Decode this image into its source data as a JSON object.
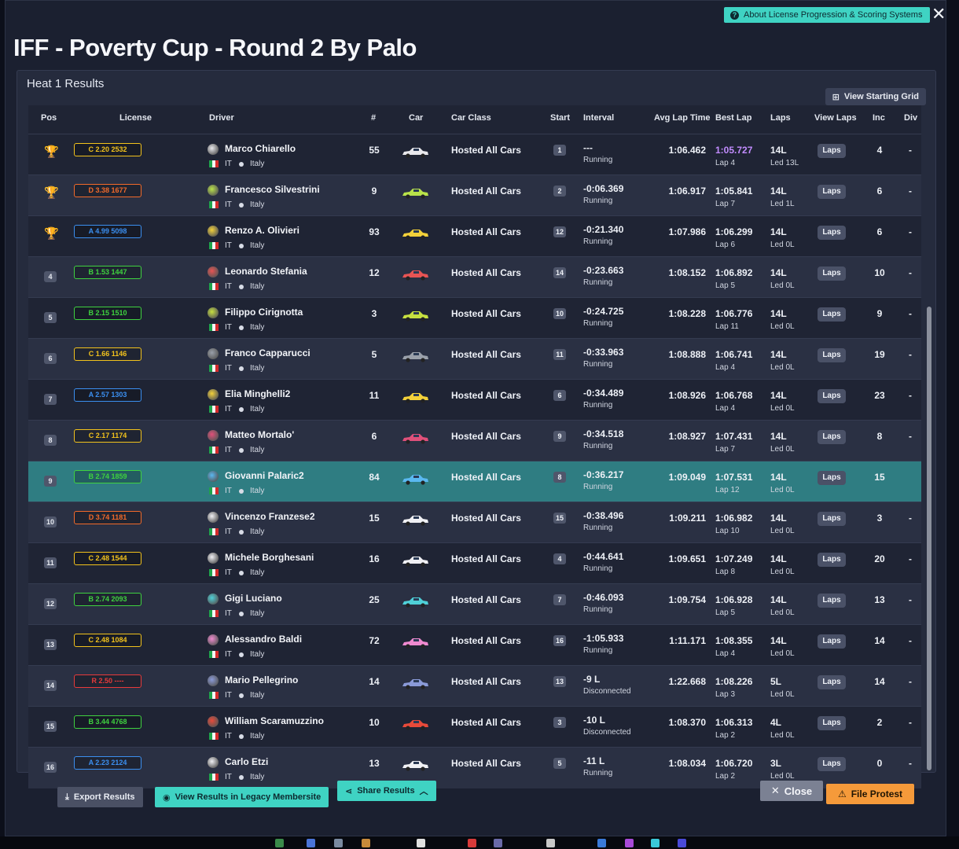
{
  "window": {
    "help_label": "About License Progression & Scoring Systems",
    "close_glyph": "✕"
  },
  "event_title": "IFF - Poverty Cup - Round 2 By Palo",
  "heat_title": "Heat 1 Results",
  "starting_grid_label": "View Starting Grid",
  "columns": {
    "pos": "Pos",
    "license": "License",
    "driver": "Driver",
    "number": "#",
    "car": "Car",
    "car_class": "Car Class",
    "start": "Start",
    "interval": "Interval",
    "avg_lap": "Avg Lap Time",
    "best_lap": "Best Lap",
    "laps": "Laps",
    "view_laps": "View Laps",
    "inc": "Inc",
    "div": "Div"
  },
  "laps_button_label": "Laps",
  "rows": [
    {
      "pos": "1",
      "trophy": "gold",
      "license": "C 2.20 2532",
      "lic_color": "#f2c21c",
      "driver": "Marco Chiarello",
      "country_code": "IT",
      "country": "Italy",
      "number": "55",
      "car_color": "#e8e8ec",
      "car_class": "Hosted All Cars",
      "start": "1",
      "interval": "---",
      "status": "Running",
      "avg": "1:06.462",
      "best": "1:05.727",
      "best_lap": "Lap 4",
      "best_purple": true,
      "laps": "14L",
      "led": "Led 13L",
      "inc": "4",
      "div": "-"
    },
    {
      "pos": "2",
      "trophy": "silver",
      "license": "D 3.38 1677",
      "lic_color": "#f26a2a",
      "driver": "Francesco Silvestrini",
      "country_code": "IT",
      "country": "Italy",
      "number": "9",
      "car_color": "#b9e34a",
      "car_class": "Hosted All Cars",
      "start": "2",
      "interval": "-0:06.369",
      "status": "Running",
      "avg": "1:06.917",
      "best": "1:05.841",
      "best_lap": "Lap 7",
      "laps": "14L",
      "led": "Led 1L",
      "inc": "6",
      "div": "-"
    },
    {
      "pos": "3",
      "trophy": "bronze",
      "license": "A 4.99 5098",
      "lic_color": "#3b8ff0",
      "driver": "Renzo A. Olivieri",
      "country_code": "IT",
      "country": "Italy",
      "number": "93",
      "car_color": "#f3d13a",
      "car_class": "Hosted All Cars",
      "start": "12",
      "interval": "-0:21.340",
      "status": "Running",
      "avg": "1:07.986",
      "best": "1:06.299",
      "best_lap": "Lap 6",
      "laps": "14L",
      "led": "Led 0L",
      "inc": "6",
      "div": "-"
    },
    {
      "pos": "4",
      "license": "B 1.53 1447",
      "lic_color": "#3fd23f",
      "driver": "Leonardo Stefania",
      "country_code": "IT",
      "country": "Italy",
      "number": "12",
      "car_color": "#e85454",
      "car_class": "Hosted All Cars",
      "start": "14",
      "interval": "-0:23.663",
      "status": "Running",
      "avg": "1:08.152",
      "best": "1:06.892",
      "best_lap": "Lap 5",
      "laps": "14L",
      "led": "Led 0L",
      "inc": "10",
      "div": "-"
    },
    {
      "pos": "5",
      "license": "B 2.15 1510",
      "lic_color": "#3fd23f",
      "driver": "Filippo Cirignotta",
      "country_code": "IT",
      "country": "Italy",
      "number": "3",
      "car_color": "#c6e040",
      "car_class": "Hosted All Cars",
      "start": "10",
      "interval": "-0:24.725",
      "status": "Running",
      "avg": "1:08.228",
      "best": "1:06.776",
      "best_lap": "Lap 11",
      "laps": "14L",
      "led": "Led 0L",
      "inc": "9",
      "div": "-"
    },
    {
      "pos": "6",
      "license": "C 1.66 1146",
      "lic_color": "#f2c21c",
      "driver": "Franco Capparucci",
      "country_code": "IT",
      "country": "Italy",
      "number": "5",
      "car_color": "#9aa0aa",
      "car_class": "Hosted All Cars",
      "start": "11",
      "interval": "-0:33.963",
      "status": "Running",
      "avg": "1:08.888",
      "best": "1:06.741",
      "best_lap": "Lap 4",
      "laps": "14L",
      "led": "Led 0L",
      "inc": "19",
      "div": "-"
    },
    {
      "pos": "7",
      "license": "A 2.57 1303",
      "lic_color": "#3b8ff0",
      "driver": "Elia Minghelli2",
      "country_code": "IT",
      "country": "Italy",
      "number": "11",
      "car_color": "#f3d13a",
      "car_class": "Hosted All Cars",
      "start": "6",
      "interval": "-0:34.489",
      "status": "Running",
      "avg": "1:08.926",
      "best": "1:06.768",
      "best_lap": "Lap 4",
      "laps": "14L",
      "led": "Led 0L",
      "inc": "23",
      "div": "-"
    },
    {
      "pos": "8",
      "license": "C 2.17 1174",
      "lic_color": "#f2c21c",
      "driver": "Matteo Mortalo'",
      "country_code": "IT",
      "country": "Italy",
      "number": "6",
      "car_color": "#e0507a",
      "car_class": "Hosted All Cars",
      "start": "9",
      "interval": "-0:34.518",
      "status": "Running",
      "avg": "1:08.927",
      "best": "1:07.431",
      "best_lap": "Lap 7",
      "laps": "14L",
      "led": "Led 0L",
      "inc": "8",
      "div": "-"
    },
    {
      "pos": "9",
      "license": "B 2.74 1859",
      "lic_color": "#3fd23f",
      "driver": "Giovanni Palaric2",
      "country_code": "IT",
      "country": "Italy",
      "number": "84",
      "car_color": "#5ab8f0",
      "car_class": "Hosted All Cars",
      "start": "8",
      "interval": "-0:36.217",
      "status": "Running",
      "avg": "1:09.049",
      "best": "1:07.531",
      "best_lap": "Lap 12",
      "laps": "14L",
      "led": "Led 0L",
      "inc": "15",
      "div": "",
      "highlight": true
    },
    {
      "pos": "10",
      "license": "D 3.74 1181",
      "lic_color": "#f26a2a",
      "driver": "Vincenzo Franzese2",
      "country_code": "IT",
      "country": "Italy",
      "number": "15",
      "car_color": "#f0f0f4",
      "car_class": "Hosted All Cars",
      "start": "15",
      "interval": "-0:38.496",
      "status": "Running",
      "avg": "1:09.211",
      "best": "1:06.982",
      "best_lap": "Lap 10",
      "laps": "14L",
      "led": "Led 0L",
      "inc": "3",
      "div": "-"
    },
    {
      "pos": "11",
      "license": "C 2.48 1544",
      "lic_color": "#f2c21c",
      "driver": "Michele Borghesani",
      "country_code": "IT",
      "country": "Italy",
      "number": "16",
      "car_color": "#f0f0f4",
      "car_class": "Hosted All Cars",
      "start": "4",
      "interval": "-0:44.641",
      "status": "Running",
      "avg": "1:09.651",
      "best": "1:07.249",
      "best_lap": "Lap 8",
      "laps": "14L",
      "led": "Led 0L",
      "inc": "20",
      "div": "-"
    },
    {
      "pos": "12",
      "license": "B 2.74 2093",
      "lic_color": "#3fd23f",
      "driver": "Gigi Luciano",
      "country_code": "IT",
      "country": "Italy",
      "number": "25",
      "car_color": "#4fd0d8",
      "car_class": "Hosted All Cars",
      "start": "7",
      "interval": "-0:46.093",
      "status": "Running",
      "avg": "1:09.754",
      "best": "1:06.928",
      "best_lap": "Lap 5",
      "laps": "14L",
      "led": "Led 0L",
      "inc": "13",
      "div": "-"
    },
    {
      "pos": "13",
      "license": "C 2.48 1084",
      "lic_color": "#f2c21c",
      "driver": "Alessandro Baldi",
      "country_code": "IT",
      "country": "Italy",
      "number": "72",
      "car_color": "#ef8ad0",
      "car_class": "Hosted All Cars",
      "start": "16",
      "interval": "-1:05.933",
      "status": "Running",
      "avg": "1:11.171",
      "best": "1:08.355",
      "best_lap": "Lap 4",
      "laps": "14L",
      "led": "Led 0L",
      "inc": "14",
      "div": "-"
    },
    {
      "pos": "14",
      "license": "R 2.50 ----",
      "lic_color": "#e83a3a",
      "driver": "Mario Pellegrino",
      "country_code": "IT",
      "country": "Italy",
      "number": "14",
      "car_color": "#8a9ad8",
      "car_class": "Hosted All Cars",
      "start": "13",
      "interval": "-9 L",
      "status": "Disconnected",
      "avg": "1:22.668",
      "best": "1:08.226",
      "best_lap": "Lap 3",
      "laps": "5L",
      "led": "Led 0L",
      "inc": "14",
      "div": "-"
    },
    {
      "pos": "15",
      "license": "B 3.44 4768",
      "lic_color": "#3fd23f",
      "driver": "William Scaramuzzino",
      "country_code": "IT",
      "country": "Italy",
      "number": "10",
      "car_color": "#e84a3a",
      "car_class": "Hosted All Cars",
      "start": "3",
      "interval": "-10 L",
      "status": "Disconnected",
      "avg": "1:08.370",
      "best": "1:06.313",
      "best_lap": "Lap 2",
      "laps": "4L",
      "led": "Led 0L",
      "inc": "2",
      "div": "-"
    },
    {
      "pos": "16",
      "license": "A 2.23 2124",
      "lic_color": "#3b8ff0",
      "driver": "Carlo Etzi",
      "country_code": "IT",
      "country": "Italy",
      "number": "13",
      "car_color": "#f0f0f4",
      "car_class": "Hosted All Cars",
      "start": "5",
      "interval": "-11 L",
      "status": "Running",
      "avg": "1:08.034",
      "best": "1:06.720",
      "best_lap": "Lap 2",
      "laps": "3L",
      "led": "Led 0L",
      "inc": "0",
      "div": "-"
    }
  ],
  "footer": {
    "export": "Export Results",
    "legacy": "View Results in Legacy Membersite",
    "share": "Share Results",
    "close": "Close",
    "protest": "File Protest"
  }
}
